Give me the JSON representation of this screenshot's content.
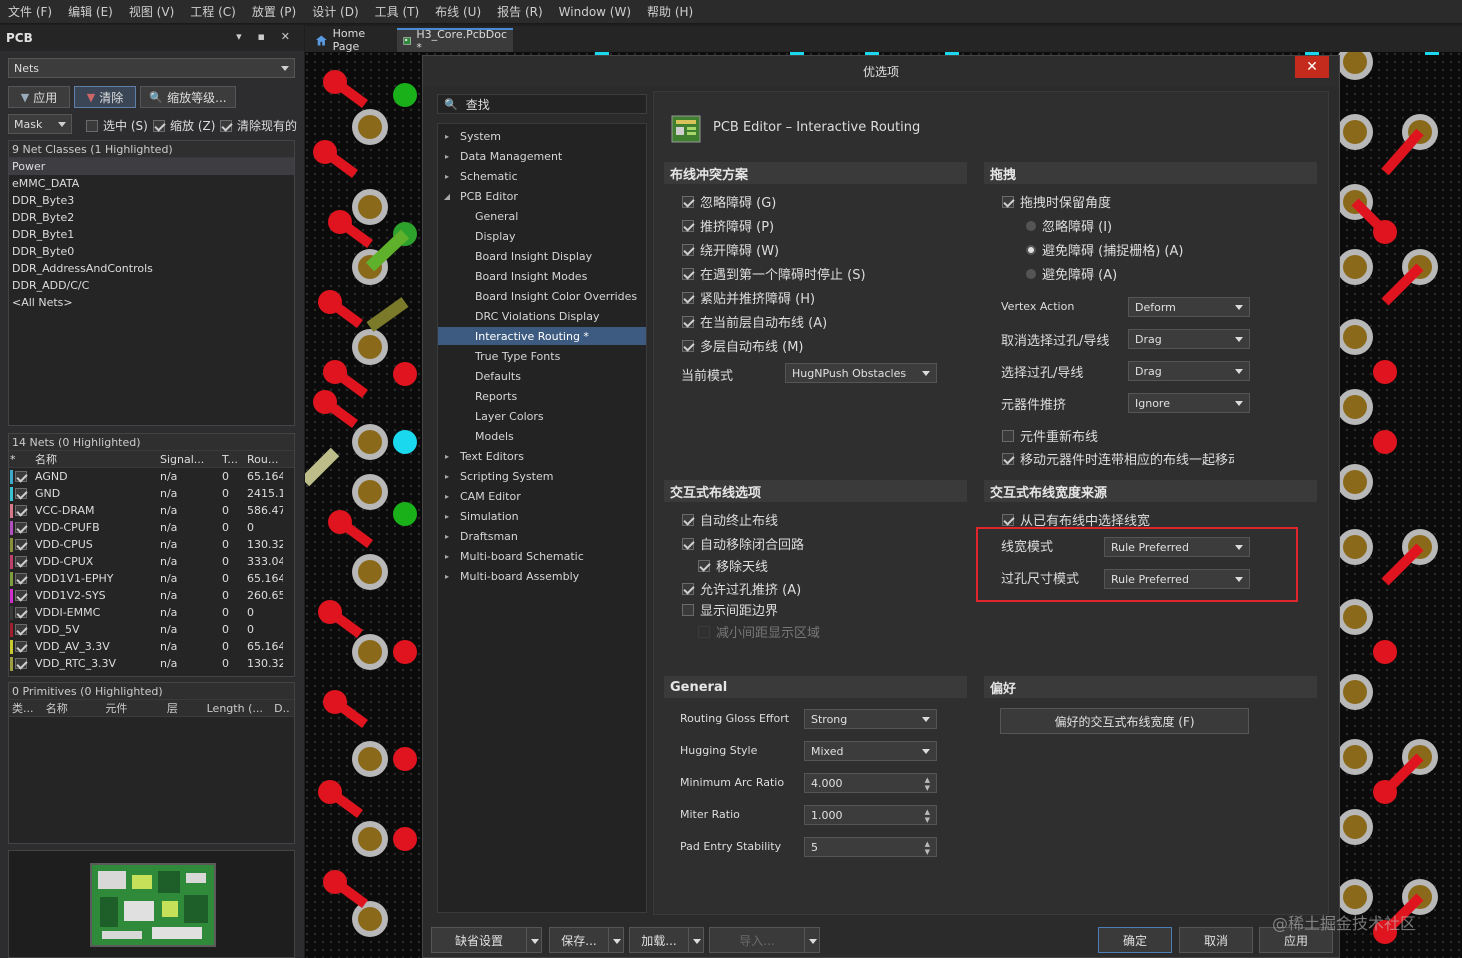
{
  "menu": [
    "文件 (F)",
    "编辑 (E)",
    "视图 (V)",
    "工程 (C)",
    "放置 (P)",
    "设计 (D)",
    "工具 (T)",
    "布线 (U)",
    "报告 (R)",
    "Window (W)",
    "帮助 (H)"
  ],
  "left_panel": {
    "title": "PCB",
    "title_controls": "▾ ▪ ✕",
    "mode_select": "Nets",
    "apply_button": "应用",
    "clear_button": "清除",
    "zoom_level_button": "缩放等级...",
    "mask_select": "Mask",
    "chk_select": "选中 (S)",
    "chk_zoom": "缩放 (Z)",
    "chk_clear_existing": "清除现有的",
    "net_classes_header": "9 Net Classes (1 Highlighted)",
    "net_classes": [
      "Power",
      "eMMC_DATA",
      "DDR_Byte3",
      "DDR_Byte2",
      "DDR_Byte1",
      "DDR_Byte0",
      "DDR_AddressAndControls",
      "DDR_ADD/C/C",
      "<All Nets>"
    ],
    "nets_header": "14 Nets (0 Highlighted)",
    "nets_columns": [
      "名称",
      "Signal...",
      "T...",
      "Rou..."
    ],
    "nets": [
      {
        "name": "AGND",
        "signal": "n/a",
        "t": "0",
        "route": "65.164",
        "color": "#3fa9c9"
      },
      {
        "name": "GND",
        "signal": "n/a",
        "t": "0",
        "route": "2415.1",
        "color": "#39c3d3"
      },
      {
        "name": "VCC-DRAM",
        "signal": "n/a",
        "t": "0",
        "route": "586.47",
        "color": "#d9788a"
      },
      {
        "name": "VDD-CPUFB",
        "signal": "n/a",
        "t": "0",
        "route": "0",
        "color": "#b24fbf"
      },
      {
        "name": "VDD-CPUS",
        "signal": "n/a",
        "t": "0",
        "route": "130.32",
        "color": "#8a8f3a"
      },
      {
        "name": "VDD-CPUX",
        "signal": "n/a",
        "t": "0",
        "route": "333.04",
        "color": "#bf3f6a"
      },
      {
        "name": "VDD1V1-EPHY",
        "signal": "n/a",
        "t": "0",
        "route": "65.164",
        "color": "#7f9f3f"
      },
      {
        "name": "VDD1V2-SYS",
        "signal": "n/a",
        "t": "0",
        "route": "260.65",
        "color": "#d02fd0"
      },
      {
        "name": "VDDI-EMMC",
        "signal": "n/a",
        "t": "0",
        "route": "0",
        "color": "#3a3a3a"
      },
      {
        "name": "VDD_5V",
        "signal": "n/a",
        "t": "0",
        "route": "0",
        "color": "#a01f2f"
      },
      {
        "name": "VDD_AV_3.3V",
        "signal": "n/a",
        "t": "0",
        "route": "65.164",
        "color": "#c8c82f"
      },
      {
        "name": "VDD_RTC_3.3V",
        "signal": "n/a",
        "t": "0",
        "route": "130.32",
        "color": "#9f9f3f"
      }
    ],
    "primitives_header": "0 Primitives (0 Highlighted)",
    "primitives_columns": [
      "类...",
      "名称",
      "元件",
      "层",
      "Length (...",
      "D.."
    ]
  },
  "tabs": [
    {
      "label": "Home Page",
      "icon": "home-icon"
    },
    {
      "label": "H3_Core.PcbDoc *",
      "icon": "pcb-doc-icon"
    }
  ],
  "dialog": {
    "title": "优选项",
    "close": "✕",
    "search_placeholder": "查找",
    "tree": [
      {
        "label": "System",
        "level": 0,
        "twisty": "▸"
      },
      {
        "label": "Data Management",
        "level": 0,
        "twisty": "▸"
      },
      {
        "label": "Schematic",
        "level": 0,
        "twisty": "▸"
      },
      {
        "label": "PCB Editor",
        "level": 0,
        "twisty": "◢"
      },
      {
        "label": "General",
        "level": 1,
        "twisty": ""
      },
      {
        "label": "Display",
        "level": 1,
        "twisty": ""
      },
      {
        "label": "Board Insight Display",
        "level": 1,
        "twisty": ""
      },
      {
        "label": "Board Insight Modes",
        "level": 1,
        "twisty": ""
      },
      {
        "label": "Board Insight Color Overrides",
        "level": 1,
        "twisty": ""
      },
      {
        "label": "DRC Violations Display",
        "level": 1,
        "twisty": ""
      },
      {
        "label": "Interactive Routing *",
        "level": 1,
        "twisty": "",
        "selected": true
      },
      {
        "label": "True Type Fonts",
        "level": 1,
        "twisty": ""
      },
      {
        "label": "Defaults",
        "level": 1,
        "twisty": ""
      },
      {
        "label": "Reports",
        "level": 1,
        "twisty": ""
      },
      {
        "label": "Layer Colors",
        "level": 1,
        "twisty": ""
      },
      {
        "label": "Models",
        "level": 1,
        "twisty": ""
      },
      {
        "label": "Text Editors",
        "level": 0,
        "twisty": "▸"
      },
      {
        "label": "Scripting System",
        "level": 0,
        "twisty": "▸"
      },
      {
        "label": "CAM Editor",
        "level": 0,
        "twisty": "▸"
      },
      {
        "label": "Simulation",
        "level": 0,
        "twisty": "▸"
      },
      {
        "label": "Draftsman",
        "level": 0,
        "twisty": "▸"
      },
      {
        "label": "Multi-board Schematic",
        "level": 0,
        "twisty": "▸"
      },
      {
        "label": "Multi-board Assembly",
        "level": 0,
        "twisty": "▸"
      }
    ],
    "page_title": "PCB Editor – Interactive Routing",
    "conflict": {
      "header": "布线冲突方案",
      "options": [
        {
          "label": "忽略障碍 (G)",
          "checked": true
        },
        {
          "label": "推挤障碍 (P)",
          "checked": true
        },
        {
          "label": "绕开障碍 (W)",
          "checked": true
        },
        {
          "label": "在遇到第一个障碍时停止 (S)",
          "checked": true
        },
        {
          "label": "紧贴并推挤障碍 (H)",
          "checked": true
        },
        {
          "label": "在当前层自动布线 (A)",
          "checked": true
        },
        {
          "label": "多层自动布线 (M)",
          "checked": true
        }
      ],
      "mode_label": "当前模式",
      "mode_value": "HugNPush Obstacles"
    },
    "drag": {
      "header": "拖拽",
      "keep_angle": "拖拽时保留角度",
      "radios": [
        {
          "label": "忽略障碍 (I)",
          "checked": false
        },
        {
          "label": "避免障碍 (捕捉栅格) (A)",
          "checked": true
        },
        {
          "label": "避免障碍 (A)",
          "checked": false
        }
      ],
      "vertex_label": "Vertex Action",
      "vertex_value": "Deform",
      "unselect_label": "取消选择过孔/导线",
      "unselect_value": "Drag",
      "select_label": "选择过孔/导线",
      "select_value": "Drag",
      "push_label": "元器件推挤",
      "push_value": "Ignore",
      "reroute": "元件重新布线",
      "move_with": "移动元器件时连带相应的布线一起移动"
    },
    "routing_opts": {
      "header": "交互式布线选项",
      "options": [
        {
          "label": "自动终止布线",
          "checked": true,
          "indent": 0,
          "disabled": false
        },
        {
          "label": "自动移除闭合回路",
          "checked": true,
          "indent": 0,
          "disabled": false
        },
        {
          "label": "移除天线",
          "checked": true,
          "indent": 1,
          "disabled": false
        },
        {
          "label": "允许过孔推挤 (A)",
          "checked": true,
          "indent": 0,
          "disabled": false
        },
        {
          "label": "显示间距边界",
          "checked": false,
          "indent": 0,
          "disabled": false
        },
        {
          "label": "减小间距显示区域",
          "checked": false,
          "indent": 1,
          "disabled": true
        }
      ]
    },
    "width_source": {
      "header": "交互式布线宽度来源",
      "pick_existing": "从已有布线中选择线宽",
      "width_mode_label": "线宽模式",
      "width_mode_value": "Rule Preferred",
      "via_mode_label": "过孔尺寸模式",
      "via_mode_value": "Rule Preferred"
    },
    "general": {
      "header": "General",
      "gloss_label": "Routing Gloss Effort",
      "gloss_value": "Strong",
      "hug_label": "Hugging Style",
      "hug_value": "Mixed",
      "arc_label": "Minimum Arc Ratio",
      "arc_value": "4.000",
      "miter_label": "Miter Ratio",
      "miter_value": "1.000",
      "pad_label": "Pad Entry Stability",
      "pad_value": "5"
    },
    "pref": {
      "header": "偏好",
      "button": "偏好的交互式布线宽度 (F)"
    },
    "footer": {
      "defaults": "缺省设置",
      "save": "保存...",
      "load": "加载...",
      "import": "导入...",
      "ok": "确定",
      "cancel": "取消",
      "apply": "应用"
    }
  },
  "watermark": "@稀土掘金技术社区"
}
